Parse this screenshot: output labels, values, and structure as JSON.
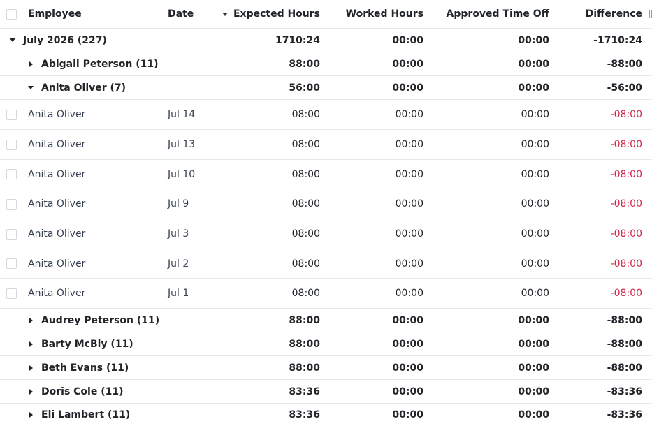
{
  "header": {
    "employee": "Employee",
    "date": "Date",
    "expected_hours": "Expected Hours",
    "worked_hours": "Worked Hours",
    "approved_time_off": "Approved Time Off",
    "difference": "Difference"
  },
  "group": {
    "label": "July 2026 (227)",
    "expected": "1710:24",
    "worked": "00:00",
    "time_off": "00:00",
    "difference": "-1710:24"
  },
  "subgroups": {
    "abigail": {
      "label": "Abigail Peterson (11)",
      "expected": "88:00",
      "worked": "00:00",
      "time_off": "00:00",
      "difference": "-88:00"
    },
    "anita": {
      "label": "Anita Oliver (7)",
      "expected": "56:00",
      "worked": "00:00",
      "time_off": "00:00",
      "difference": "-56:00"
    },
    "audrey": {
      "label": "Audrey Peterson (11)",
      "expected": "88:00",
      "worked": "00:00",
      "time_off": "00:00",
      "difference": "-88:00"
    },
    "barty": {
      "label": "Barty McBly (11)",
      "expected": "88:00",
      "worked": "00:00",
      "time_off": "00:00",
      "difference": "-88:00"
    },
    "beth": {
      "label": "Beth Evans (11)",
      "expected": "88:00",
      "worked": "00:00",
      "time_off": "00:00",
      "difference": "-88:00"
    },
    "doris": {
      "label": "Doris Cole (11)",
      "expected": "83:36",
      "worked": "00:00",
      "time_off": "00:00",
      "difference": "-83:36"
    },
    "eli": {
      "label": "Eli Lambert (11)",
      "expected": "83:36",
      "worked": "00:00",
      "time_off": "00:00",
      "difference": "-83:36"
    }
  },
  "records": [
    {
      "employee": "Anita Oliver",
      "date": "Jul 14",
      "expected": "08:00",
      "worked": "00:00",
      "time_off": "00:00",
      "difference": "-08:00"
    },
    {
      "employee": "Anita Oliver",
      "date": "Jul 13",
      "expected": "08:00",
      "worked": "00:00",
      "time_off": "00:00",
      "difference": "-08:00"
    },
    {
      "employee": "Anita Oliver",
      "date": "Jul 10",
      "expected": "08:00",
      "worked": "00:00",
      "time_off": "00:00",
      "difference": "-08:00"
    },
    {
      "employee": "Anita Oliver",
      "date": "Jul 9",
      "expected": "08:00",
      "worked": "00:00",
      "time_off": "00:00",
      "difference": "-08:00"
    },
    {
      "employee": "Anita Oliver",
      "date": "Jul 3",
      "expected": "08:00",
      "worked": "00:00",
      "time_off": "00:00",
      "difference": "-08:00"
    },
    {
      "employee": "Anita Oliver",
      "date": "Jul 2",
      "expected": "08:00",
      "worked": "00:00",
      "time_off": "00:00",
      "difference": "-08:00"
    },
    {
      "employee": "Anita Oliver",
      "date": "Jul 1",
      "expected": "08:00",
      "worked": "00:00",
      "time_off": "00:00",
      "difference": "-08:00"
    }
  ],
  "colors": {
    "negative_difference": "#d0274c",
    "row_border": "#e7e9ed"
  }
}
